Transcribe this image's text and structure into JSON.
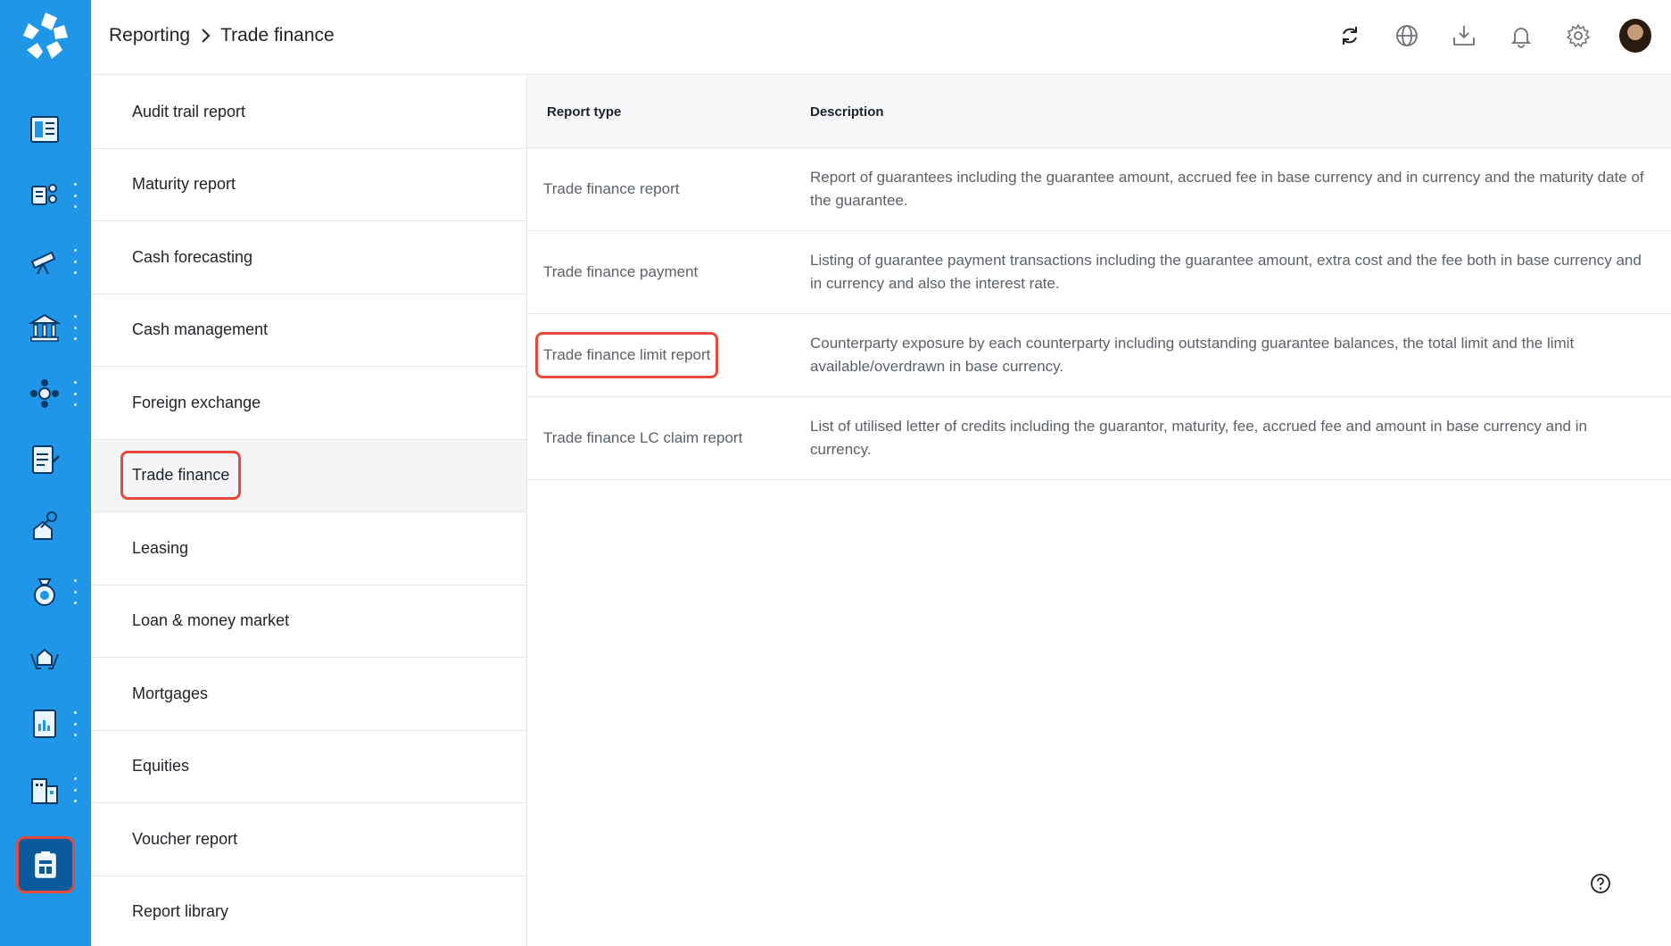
{
  "breadcrumb": {
    "parent": "Reporting",
    "current": "Trade finance"
  },
  "rail": {
    "items": [
      {
        "icon": "dashboard-icon",
        "has_menu": false
      },
      {
        "icon": "accounts-icon",
        "has_menu": true
      },
      {
        "icon": "telescope-icon",
        "has_menu": true
      },
      {
        "icon": "bank-icon",
        "has_menu": true
      },
      {
        "icon": "network-icon",
        "has_menu": true
      },
      {
        "icon": "invoice-icon",
        "has_menu": false
      },
      {
        "icon": "property-key-icon",
        "has_menu": false
      },
      {
        "icon": "money-bag-icon",
        "has_menu": true
      },
      {
        "icon": "hands-house-icon",
        "has_menu": false
      },
      {
        "icon": "report-book-icon",
        "has_menu": true
      },
      {
        "icon": "buildings-icon",
        "has_menu": true
      }
    ],
    "active_icon": "reporting-clipboard-icon"
  },
  "topbar": {
    "icons": [
      "refresh-icon",
      "globe-icon",
      "download-tray-icon",
      "bell-icon",
      "gear-icon",
      "user-avatar"
    ]
  },
  "nav": {
    "items": [
      "Audit trail report",
      "Maturity report",
      "Cash forecasting",
      "Cash management",
      "Foreign exchange",
      "Trade finance",
      "Leasing",
      "Loan & money market",
      "Mortgages",
      "Equities",
      "Voucher report",
      "Report library"
    ],
    "selected": "Trade finance"
  },
  "table": {
    "headers": {
      "type": "Report type",
      "description": "Description"
    },
    "rows": [
      {
        "type": "Trade finance report",
        "description": "Report of guarantees including the guarantee amount, accrued fee in base currency and in currency and the maturity date of the guarantee."
      },
      {
        "type": "Trade finance payment",
        "description": "Listing of guarantee payment transactions including the guarantee amount, extra cost and the fee both in base currency and in currency and also the interest rate."
      },
      {
        "type": "Trade finance limit report",
        "description": "Counterparty exposure by each counterparty including outstanding guarantee balances, the total limit and the limit available/overdrawn in base currency."
      },
      {
        "type": "Trade finance LC claim report",
        "description": "List of utilised letter of credits including the guarantor, maturity, fee, accrued fee and amount in base currency and in currency."
      }
    ],
    "highlighted_row": "Trade finance limit report"
  },
  "colors": {
    "rail": "#1f96e8",
    "rail_active": "#0b5a9c",
    "highlight": "#e9493c"
  }
}
